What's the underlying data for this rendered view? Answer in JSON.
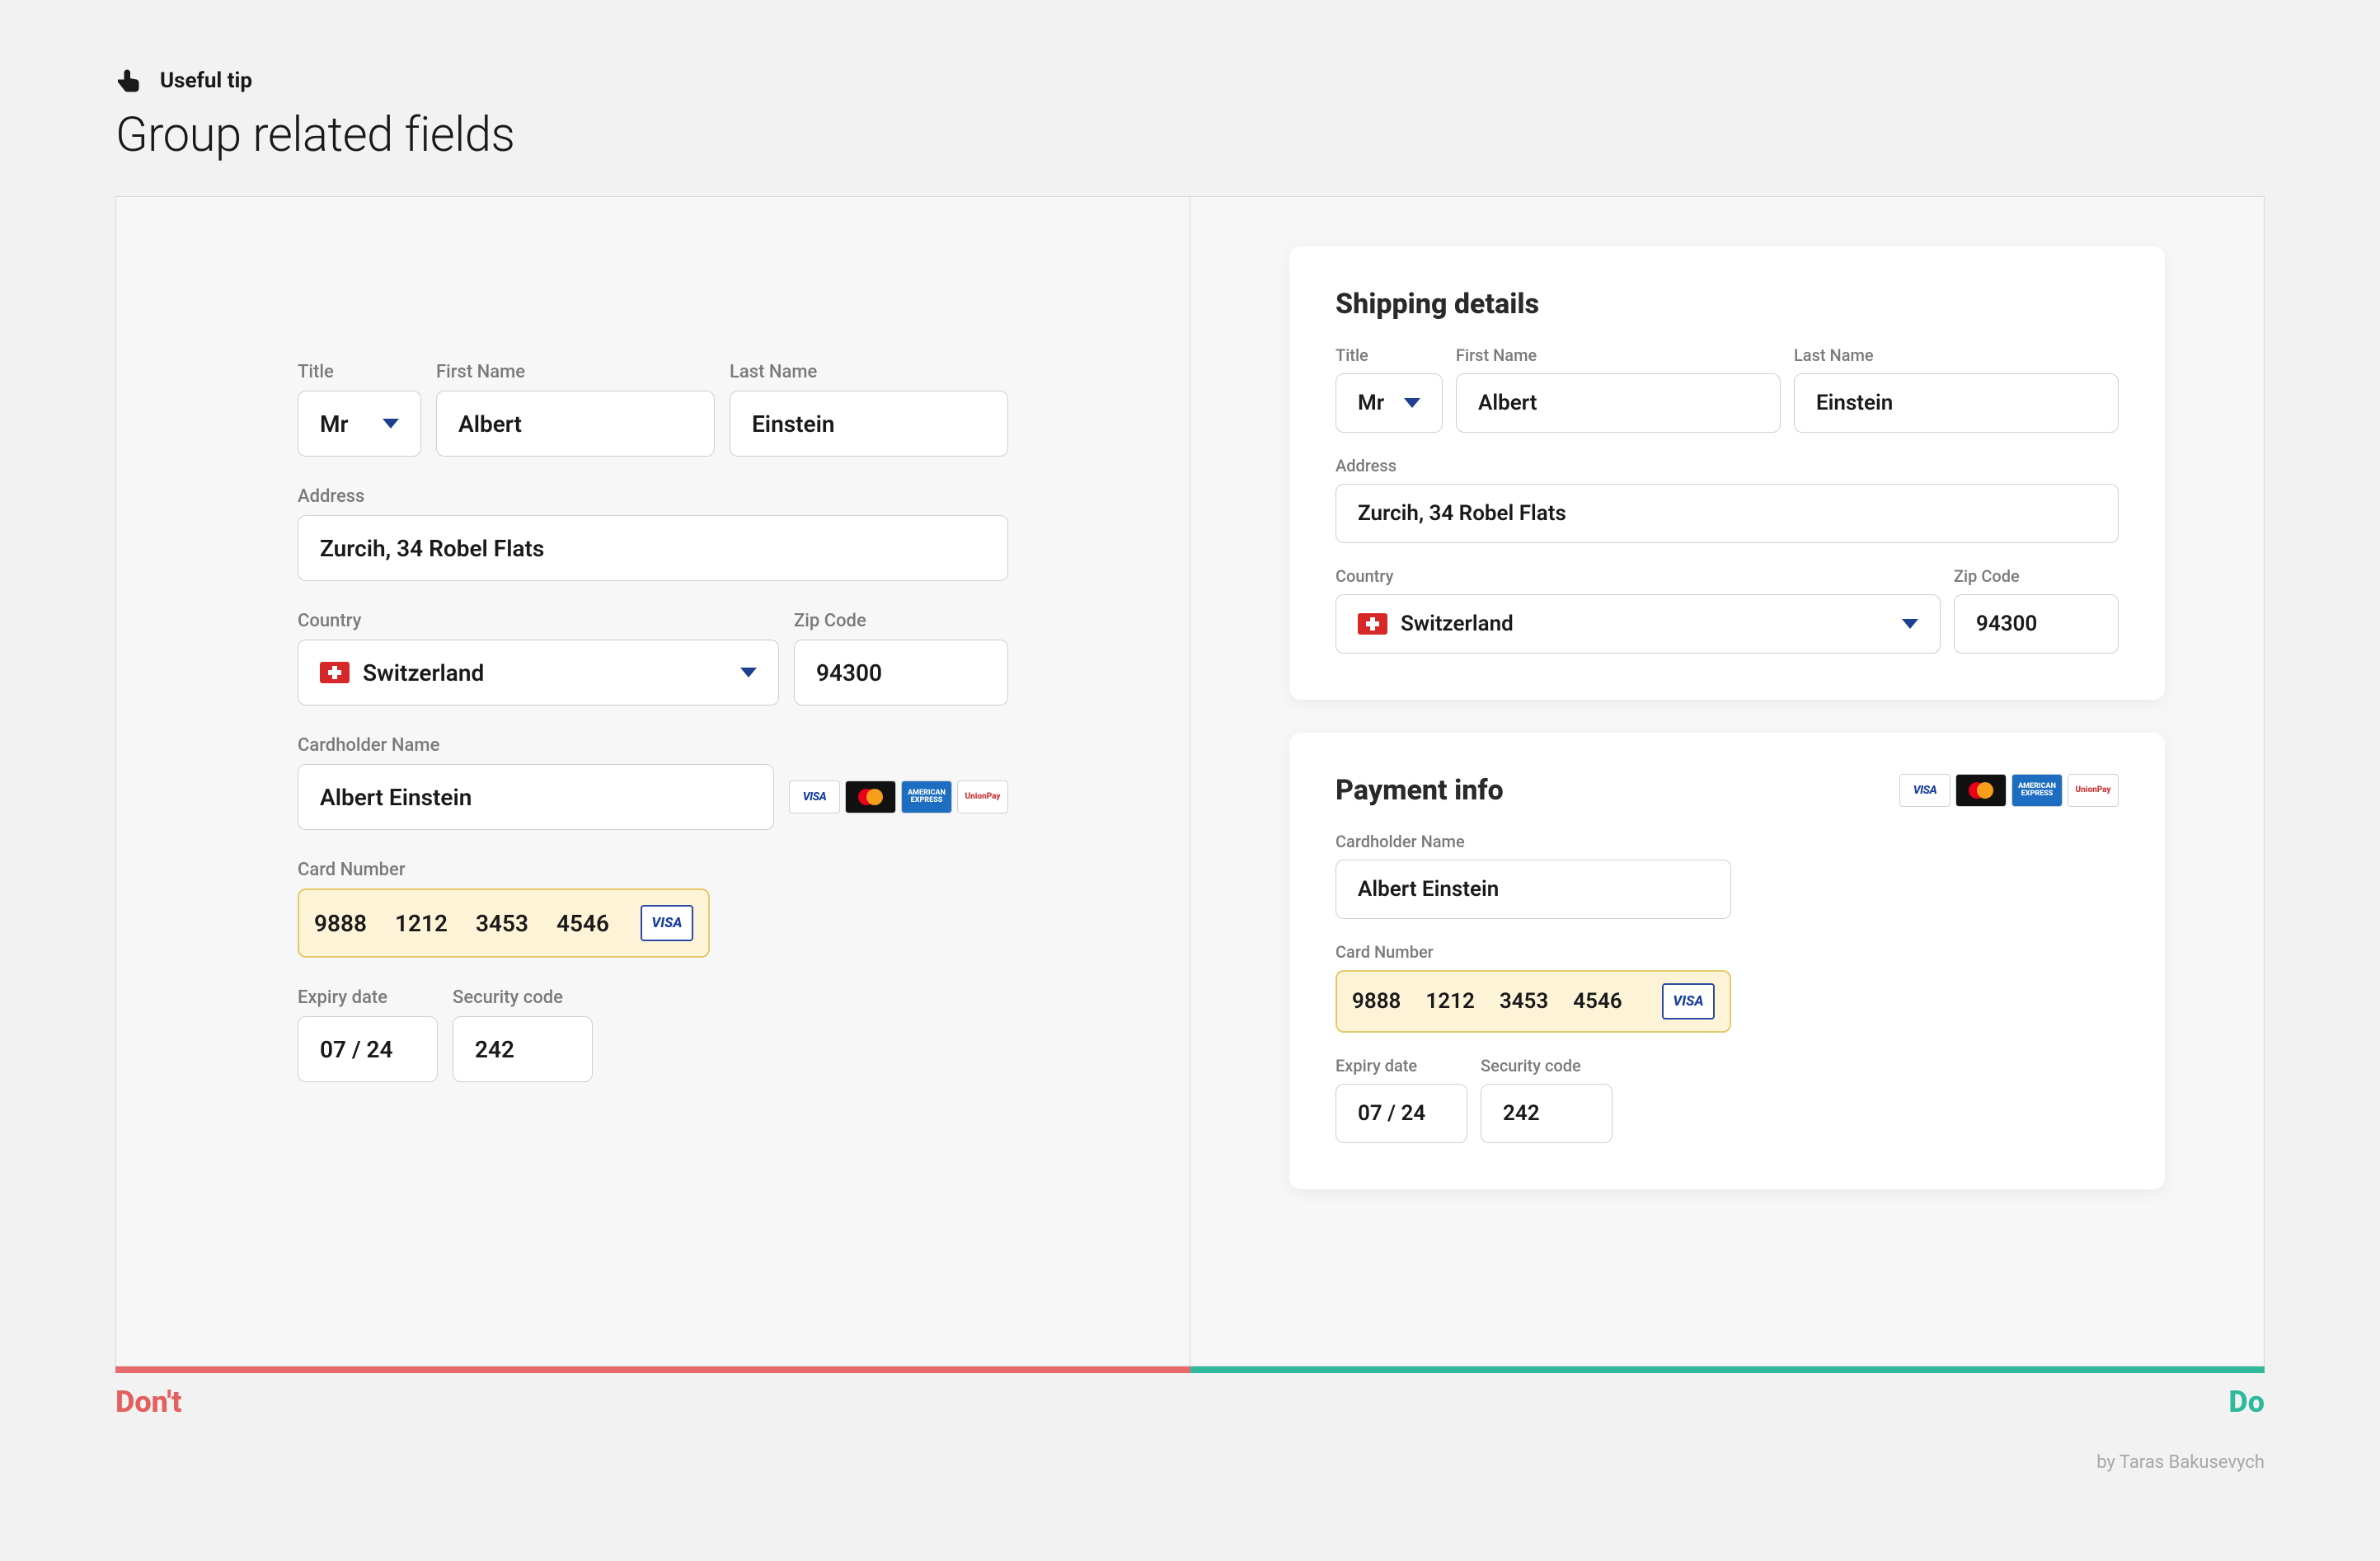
{
  "header": {
    "tip_label": "Useful tip",
    "title": "Group related fields"
  },
  "labels": {
    "title": "Title",
    "first_name": "First Name",
    "last_name": "Last Name",
    "address": "Address",
    "country": "Country",
    "zip": "Zip Code",
    "cardholder": "Cardholder Name",
    "cardnum": "Card Number",
    "expiry": "Expiry date",
    "security": "Security code"
  },
  "values": {
    "title": "Mr",
    "first_name": "Albert",
    "last_name": "Einstein",
    "address": "Zurcih, 34 Robel Flats",
    "country": "Switzerland",
    "zip": "94300",
    "cardholder": "Albert Einstein",
    "card_g1": "9888",
    "card_g2": "1212",
    "card_g3": "3453",
    "card_g4": "4546",
    "expiry": "07 / 24",
    "security": "242"
  },
  "panels": {
    "shipping": "Shipping details",
    "payment": "Payment info"
  },
  "card_brands": {
    "visa": "VISA",
    "amex": "AMERICAN EXPRESS",
    "unionpay": "UnionPay"
  },
  "footer": {
    "dont": "Don't",
    "do": "Do",
    "credit": "by Taras Bakusevych"
  },
  "colors": {
    "dont": "#e86b6b",
    "do": "#2fb89a",
    "select_accent": "#1f3f8f",
    "card_highlight_bg": "#fdf4d8",
    "card_highlight_border": "#e5c96c"
  }
}
